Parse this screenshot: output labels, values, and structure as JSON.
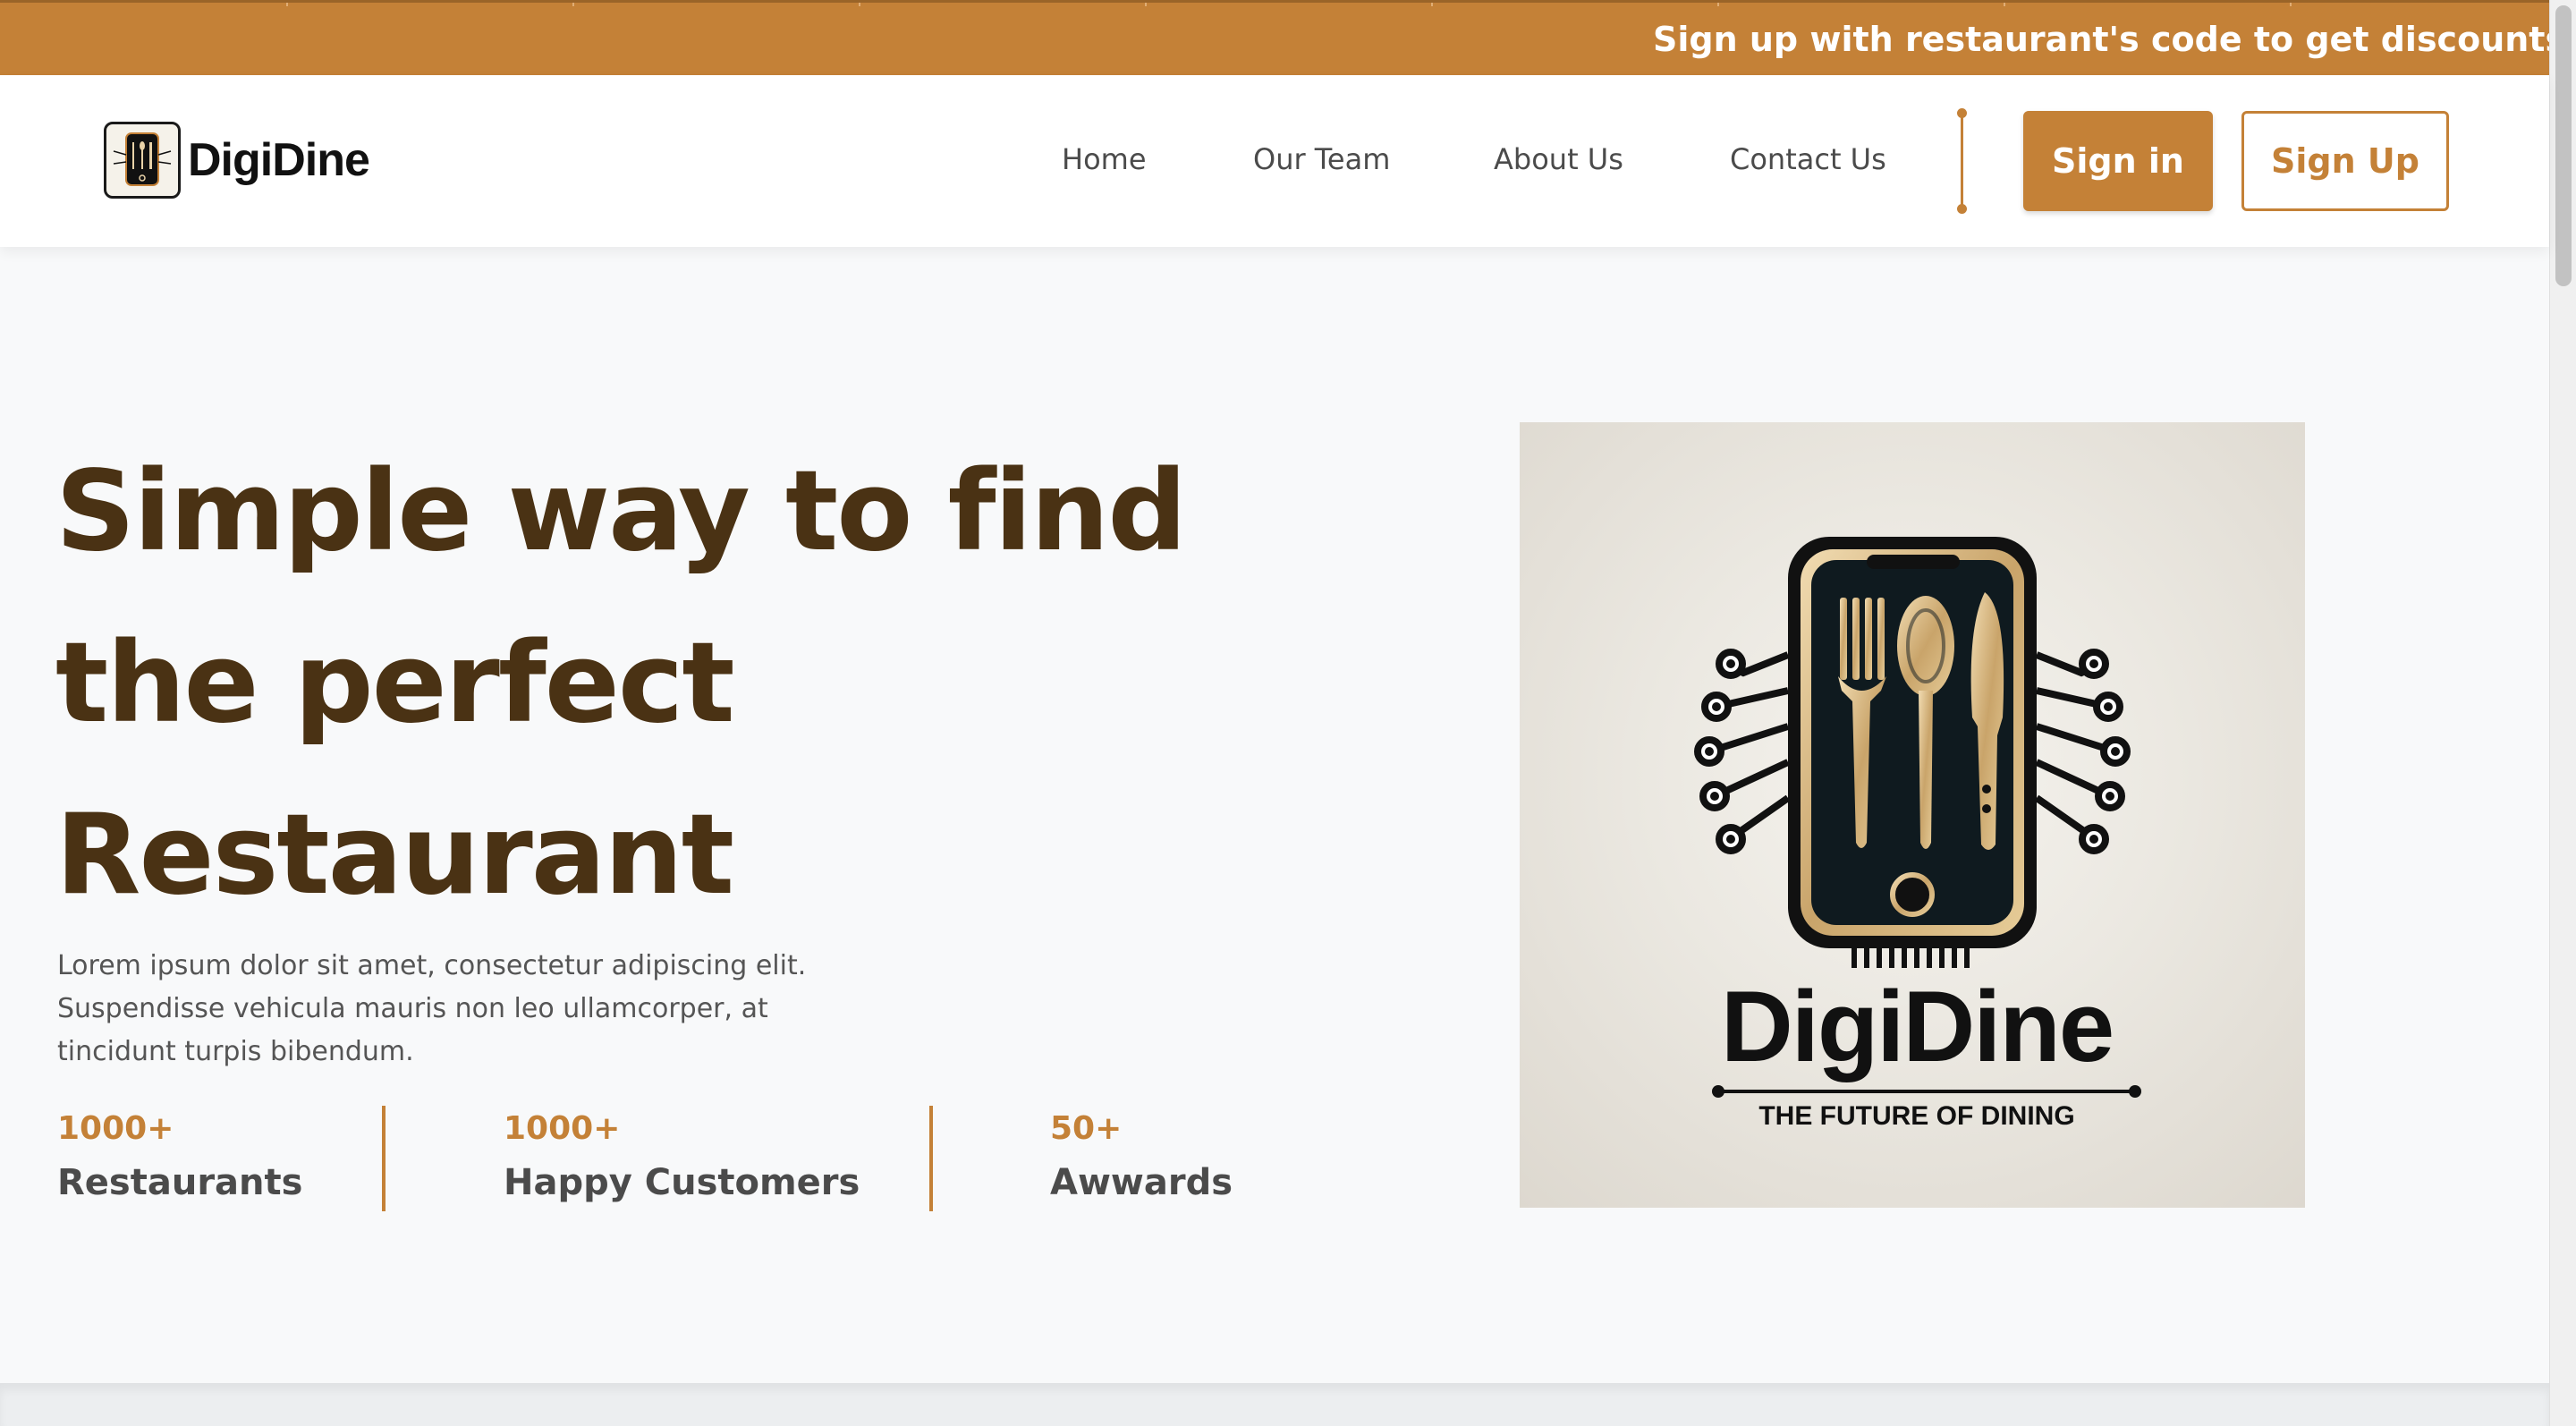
{
  "announcement": {
    "text": "Sign up with restaurant's code to get discounts. Visit r"
  },
  "brand": {
    "name": "DigiDine"
  },
  "nav": {
    "links": [
      "Home",
      "Our Team",
      "About Us",
      "Contact Us"
    ],
    "signin_label": "Sign in",
    "signup_label": "Sign Up"
  },
  "hero": {
    "title_lines": [
      "Simple way to find",
      "the perfect",
      "Restaurant"
    ],
    "description": "Lorem ipsum dolor sit amet, consectetur adipiscing elit. Suspendisse vehicula mauris non leo ullamcorper, at tincidunt turpis bibendum.",
    "stats": [
      {
        "value": "1000+",
        "label": "Restaurants"
      },
      {
        "value": "1000+",
        "label": "Happy Customers"
      },
      {
        "value": "50+",
        "label": "Awwards"
      }
    ],
    "image": {
      "brand_text": "DigiDine",
      "tagline": "THE FUTURE OF DINING"
    }
  },
  "colors": {
    "accent": "#c48137",
    "title": "#4a3214",
    "hero_bg": "#f8f9fa"
  },
  "icons": {
    "logo": "phone-utensils-logo-icon"
  }
}
